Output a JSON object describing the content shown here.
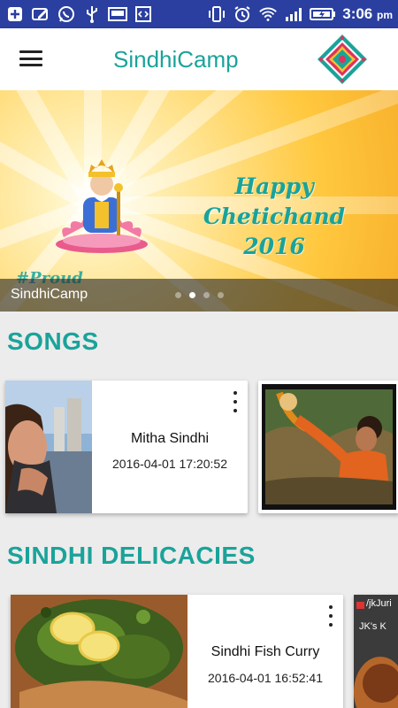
{
  "status_bar": {
    "left_icons": [
      "plus-box-icon",
      "edit-icon",
      "whatsapp-icon",
      "usb-icon",
      "screenshot-icon",
      "code-icon"
    ],
    "right_icons": [
      "vibrate-icon",
      "alarm-icon",
      "wifi-icon",
      "signal-icon",
      "battery-icon"
    ],
    "time": "3:06",
    "ampm": "pm"
  },
  "app_bar": {
    "title": "SindhiCamp",
    "menu_icon": "hamburger-menu-icon",
    "logo_icon": "sindhicamp-logo-icon"
  },
  "banner": {
    "headline_line1": "Happy Chetichand",
    "headline_line2": "2016",
    "watermark": "#Proud",
    "caption": "SindhiCamp",
    "slides": 4,
    "active_slide": 2
  },
  "sections": [
    {
      "title": "SONGS",
      "items": [
        {
          "title": "Mitha Sindhi",
          "date": "2016-04-01 17:20:52"
        },
        {
          "title": "",
          "date": ""
        }
      ]
    },
    {
      "title": "SINDHI DELICACIES",
      "items": [
        {
          "title": "Sindhi Fish Curry",
          "date": "2016-04-01 16:52:41"
        },
        {
          "title": "",
          "date": ""
        }
      ]
    }
  ],
  "peek_thumb_text": "/jkJuri",
  "peek_thumb_text2": "JK's K",
  "colors": {
    "status_bar": "#2a3f9f",
    "accent": "#1aa39a",
    "background": "#ececec"
  }
}
